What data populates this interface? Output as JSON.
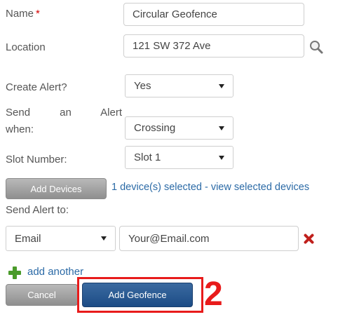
{
  "form": {
    "name_label": "Name",
    "required_mark": "*",
    "name_value": "Circular Geofence",
    "location_label": "Location",
    "location_value": "121 SW 372 Ave",
    "create_alert_label": "Create Alert?",
    "create_alert_value": "Yes",
    "send_alert_when_label_line1": "Send an Alert",
    "send_alert_when_label_line2": "when:",
    "send_alert_when_value": "Crossing",
    "slot_number_label": "Slot Number:",
    "slot_number_value": "Slot 1",
    "add_devices_label": "Add Devices",
    "devices_selected_link": "1 device(s) selected - view selected devices",
    "send_alert_to_label": "Send Alert to:",
    "alert_method_value": "Email",
    "alert_address_value": "Your@Email.com",
    "add_another_label": "add another",
    "cancel_label": "Cancel",
    "add_geofence_label": "Add Geofence"
  },
  "annotation": {
    "step_number": "2"
  },
  "icons": {
    "location_search": "magnifier-icon",
    "remove_recipient": "red-x-icon",
    "add_another": "green-plus-icon"
  },
  "colors": {
    "required": "#d40000",
    "link": "#2b6aa6",
    "primary_button": "#1c4c86",
    "highlight": "#e81b1b"
  }
}
